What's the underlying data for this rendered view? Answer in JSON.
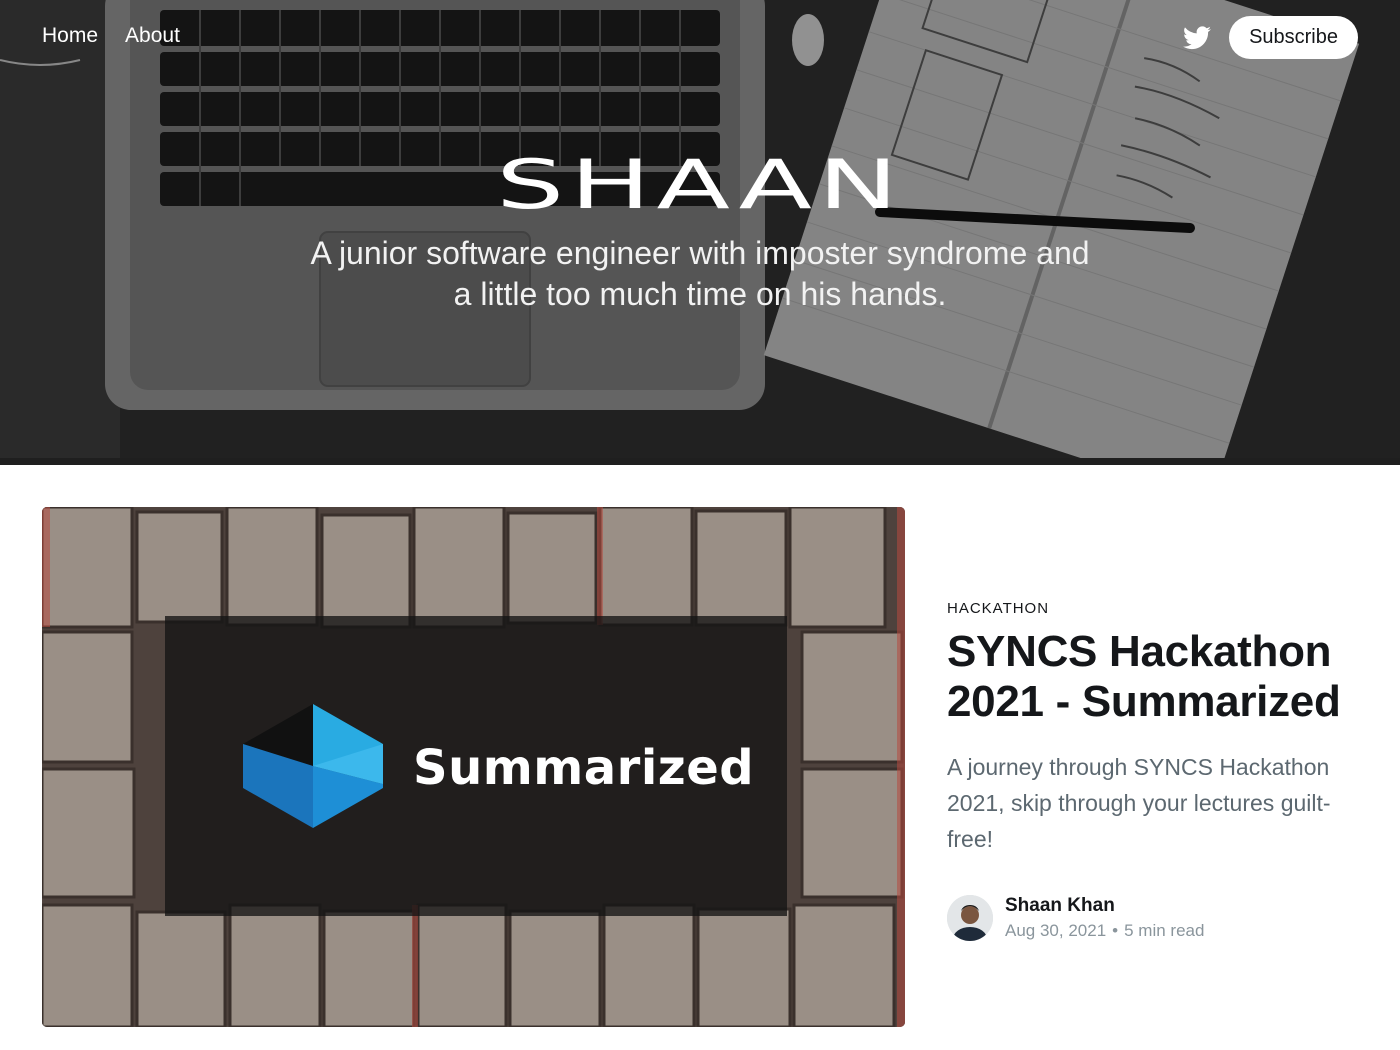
{
  "header": {
    "nav": [
      {
        "label": "Home"
      },
      {
        "label": "About"
      }
    ],
    "social_icon": "twitter-icon",
    "subscribe_label": "Subscribe",
    "site_title": "SHAAN",
    "site_description": "A junior software engineer with imposter syndrome and a little too much time on his hands."
  },
  "featured_post": {
    "image_text": "Summarized",
    "image_icon": "cube-logo-icon",
    "tag": "HACKATHON",
    "title": "SYNCS Hackathon 2021 - Summarized",
    "excerpt": "A journey through SYNCS Hackathon 2021, skip through your lectures guilt-free!",
    "author": "Shaan Khan",
    "date": "Aug 30, 2021",
    "separator": "•",
    "reading_time": "5 min read"
  },
  "colors": {
    "text_dark": "#15171a",
    "excerpt_gray": "#5c6870",
    "meta_gray": "#8a959c",
    "cube_blue_light": "#29abe2",
    "cube_blue_dark": "#1b75bc"
  }
}
